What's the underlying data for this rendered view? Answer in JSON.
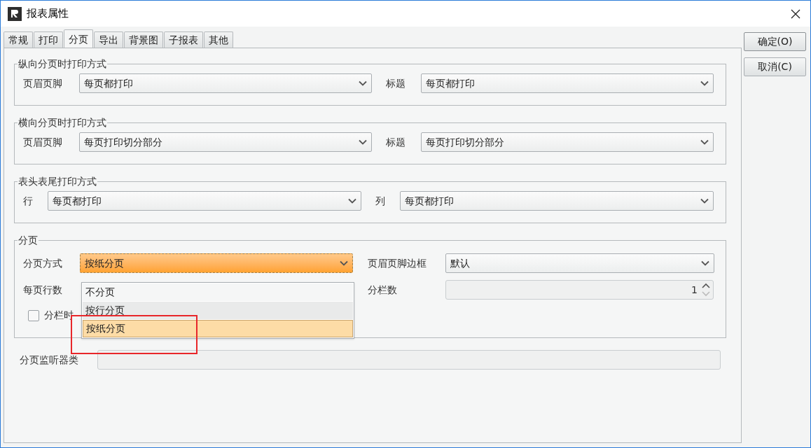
{
  "window": {
    "title": "报表属性"
  },
  "tabs": [
    {
      "label": "常规",
      "selected": false
    },
    {
      "label": "打印",
      "selected": false
    },
    {
      "label": "分页",
      "selected": true
    },
    {
      "label": "导出",
      "selected": false
    },
    {
      "label": "背景图",
      "selected": false
    },
    {
      "label": "子报表",
      "selected": false
    },
    {
      "label": "其他",
      "selected": false
    }
  ],
  "groups": [
    {
      "title": "纵向分页时打印方式",
      "fields": [
        {
          "label": "页眉页脚",
          "value": "每页都打印"
        },
        {
          "label": "标题",
          "value": "每页都打印"
        }
      ]
    },
    {
      "title": "横向分页时打印方式",
      "fields": [
        {
          "label": "页眉页脚",
          "value": "每页打印切分部分"
        },
        {
          "label": "标题",
          "value": "每页打印切分部分"
        }
      ]
    },
    {
      "title": "表头表尾打印方式",
      "fields": [
        {
          "label": "行",
          "value": "每页都打印"
        },
        {
          "label": "列",
          "value": "每页都打印"
        }
      ]
    }
  ],
  "paging": {
    "title": "分页",
    "mode": {
      "label": "分页方式",
      "value": "按纸分页",
      "expanded": true,
      "options": [
        {
          "label": "不分页",
          "selected": false,
          "hovered": false
        },
        {
          "label": "按行分页",
          "selected": false,
          "hovered": true
        },
        {
          "label": "按纸分页",
          "selected": true,
          "hovered": false
        }
      ]
    },
    "border": {
      "label": "页眉页脚边框",
      "value": "默认"
    },
    "rows_per_page": {
      "label": "每页行数"
    },
    "columns": {
      "label": "分栏数",
      "value": "1"
    },
    "repeat": {
      "label": "分栏时",
      "checked": false
    }
  },
  "listener": {
    "label": "分页监听器类"
  },
  "buttons": [
    {
      "label": "确定(O)"
    },
    {
      "label": "取消(C)"
    }
  ]
}
